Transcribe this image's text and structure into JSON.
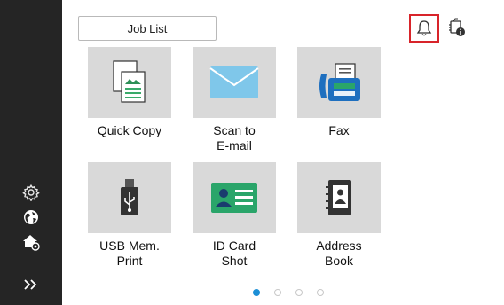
{
  "header": {
    "job_list_label": "Job List"
  },
  "icons": {
    "notification": "bell-icon",
    "machine_status": "machine-status-icon",
    "settings": "gear-icon",
    "language": "globe-icon",
    "home_settings": "home-settings-icon",
    "expand": "double-chevron-right-icon"
  },
  "tiles": [
    {
      "label_line1": "Quick Copy",
      "label_line2": ""
    },
    {
      "label_line1": "Scan to",
      "label_line2": "E-mail"
    },
    {
      "label_line1": "Fax",
      "label_line2": ""
    },
    {
      "label_line1": "USB Mem.",
      "label_line2": "Print"
    },
    {
      "label_line1": "ID Card",
      "label_line2": "Shot"
    },
    {
      "label_line1": "Address",
      "label_line2": "Book"
    }
  ],
  "pagination": {
    "pages": 4,
    "current": 1
  },
  "colors": {
    "accent": "#1c8fd6",
    "highlight": "#d8242a",
    "sidebar": "#252525",
    "tile": "#d9d9d9",
    "fax_green": "#2aa56a",
    "doc_green": "#3aaa6a"
  }
}
